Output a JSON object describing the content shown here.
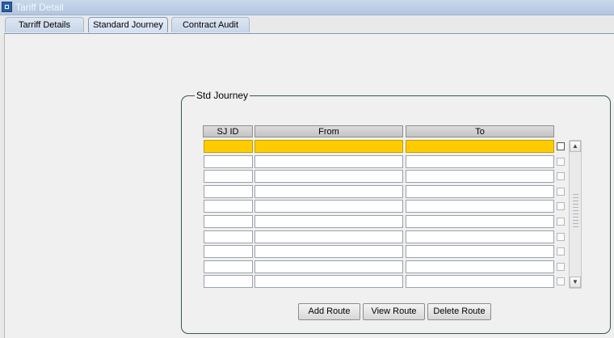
{
  "window": {
    "title": "Tariff Detail"
  },
  "tabs": [
    {
      "label": "Tarriff Details",
      "active": false
    },
    {
      "label": "Standard Journey",
      "active": true
    },
    {
      "label": "Contract Audit",
      "active": false
    }
  ],
  "std_journey": {
    "group_label": "Std Journey",
    "columns": [
      "SJ ID",
      "From",
      "To"
    ],
    "rows": [
      {
        "sj_id": "",
        "from": "",
        "to": "",
        "selected": true
      },
      {
        "sj_id": "",
        "from": "",
        "to": "",
        "selected": false
      },
      {
        "sj_id": "",
        "from": "",
        "to": "",
        "selected": false
      },
      {
        "sj_id": "",
        "from": "",
        "to": "",
        "selected": false
      },
      {
        "sj_id": "",
        "from": "",
        "to": "",
        "selected": false
      },
      {
        "sj_id": "",
        "from": "",
        "to": "",
        "selected": false
      },
      {
        "sj_id": "",
        "from": "",
        "to": "",
        "selected": false
      },
      {
        "sj_id": "",
        "from": "",
        "to": "",
        "selected": false
      },
      {
        "sj_id": "",
        "from": "",
        "to": "",
        "selected": false
      },
      {
        "sj_id": "",
        "from": "",
        "to": "",
        "selected": false
      }
    ],
    "buttons": {
      "add_route": "Add Route",
      "view_route": "View Route",
      "delete_route": "Delete Route"
    }
  },
  "icons": {
    "window": "app-window-icon",
    "scroll_up": "arrow-up-icon",
    "scroll_down": "arrow-down-icon"
  },
  "colors": {
    "selected_row": "#ffcc00",
    "titlebar": "#b3c6e0",
    "group_border": "#2f5a57"
  }
}
